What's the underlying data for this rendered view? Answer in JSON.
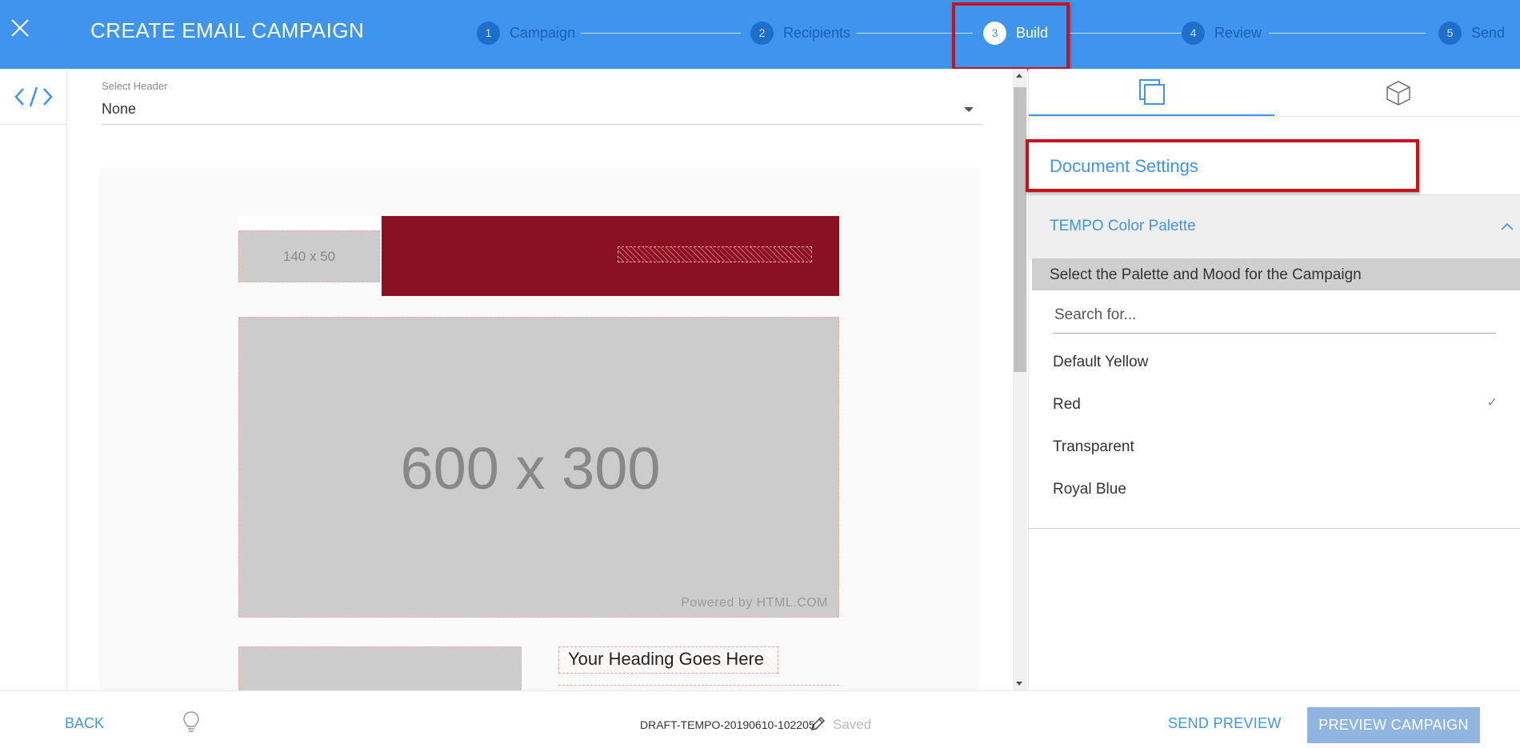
{
  "header": {
    "title": "CREATE EMAIL CAMPAIGN",
    "steps": [
      {
        "num": "1",
        "label": "Campaign"
      },
      {
        "num": "2",
        "label": "Recipients"
      },
      {
        "num": "3",
        "label": "Build"
      },
      {
        "num": "4",
        "label": "Review"
      },
      {
        "num": "5",
        "label": "Send"
      }
    ],
    "active_step": "Build"
  },
  "editor": {
    "select_header_label": "Select Header",
    "select_header_value": "None",
    "logo_placeholder": "140 x 50",
    "hero_placeholder": "600 x 300",
    "hero_credit": "Powered by HTML.COM",
    "heading_placeholder": "Your Heading Goes Here"
  },
  "panel": {
    "section_title": "Document Settings",
    "accordion_title": "TEMPO Color Palette",
    "palette_prompt": "Select the Palette and Mood for the Campaign",
    "search_placeholder": "Search for...",
    "options": [
      "Default Yellow",
      "Red",
      "Transparent",
      "Royal Blue"
    ],
    "selected_option": "Red"
  },
  "footer": {
    "back_label": "BACK",
    "draft_name": "DRAFT-TEMPO-20190610-102205",
    "saved_label": "Saved",
    "send_preview_label": "SEND PREVIEW",
    "preview_campaign_label": "PREVIEW CAMPAIGN"
  },
  "colors": {
    "brand_blue": "#3f94ec",
    "banner_red": "#8a1121",
    "highlight_red": "#c8111c",
    "preview_button": "#8fb5e0"
  },
  "icons": [
    "close-icon",
    "code-icon",
    "copy-icon",
    "cube-icon",
    "chevron-up-icon",
    "check-icon",
    "lightbulb-icon",
    "pencil-icon",
    "dropdown-caret-icon"
  ]
}
